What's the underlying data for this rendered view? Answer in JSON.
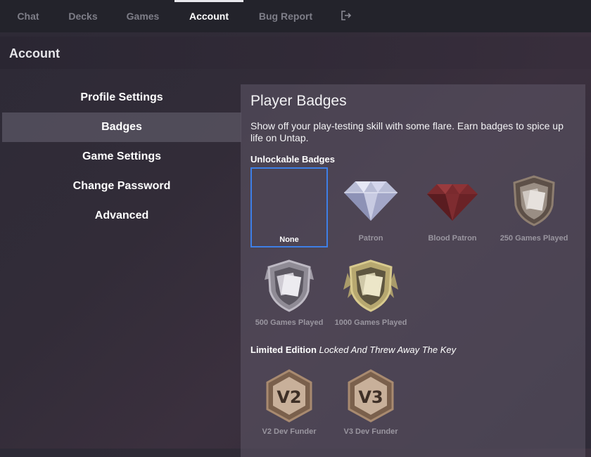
{
  "nav": {
    "items": [
      {
        "label": "Chat"
      },
      {
        "label": "Decks"
      },
      {
        "label": "Games"
      },
      {
        "label": "Account"
      },
      {
        "label": "Bug Report"
      }
    ],
    "active": "Account",
    "logout_icon": "logout-icon"
  },
  "page": {
    "title": "Account"
  },
  "sidebar": {
    "items": [
      {
        "label": "Profile Settings"
      },
      {
        "label": "Badges"
      },
      {
        "label": "Game Settings"
      },
      {
        "label": "Change Password"
      },
      {
        "label": "Advanced"
      }
    ],
    "active": "Badges"
  },
  "panel": {
    "title": "Player Badges",
    "description": "Show off your play-testing skill with some flare. Earn badges to spice up life on Untap.",
    "unlockable_heading": "Unlockable Badges",
    "unlockable": [
      {
        "caption": "None",
        "icon": "none",
        "selected": true
      },
      {
        "caption": "Patron",
        "icon": "diamond-icon"
      },
      {
        "caption": "Blood Patron",
        "icon": "red-diamond-icon"
      },
      {
        "caption": "250 Games Played",
        "icon": "bronze-shield-icon"
      },
      {
        "caption": "500 Games Played",
        "icon": "silver-shield-icon"
      },
      {
        "caption": "1000 Games Played",
        "icon": "gold-winged-shield-icon"
      }
    ],
    "limited_heading": "Limited Edition",
    "limited_subheading": "Locked And Threw Away The Key",
    "limited": [
      {
        "caption": "V2 Dev Funder",
        "icon": "v2-hexagon-icon",
        "text": "V2"
      },
      {
        "caption": "V3 Dev Funder",
        "icon": "v3-hexagon-icon",
        "text": "V3"
      }
    ]
  },
  "colors": {
    "accent": "#3e7fe6",
    "nav_bg": "#23232b"
  }
}
